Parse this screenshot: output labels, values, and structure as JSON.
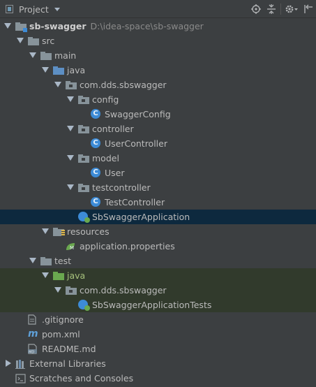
{
  "header": {
    "title": "Project",
    "tools": [
      "target-icon",
      "collapse-icon",
      "gear-icon",
      "hide-icon"
    ]
  },
  "tree": [
    {
      "label": "sb-swagger",
      "hint": "D:\\idea-space\\sb-swagger",
      "icon": "module-folder-icon",
      "indent": 0,
      "toggle": "open",
      "bold": true
    },
    {
      "label": "src",
      "icon": "folder-icon",
      "indent": 1,
      "toggle": "open"
    },
    {
      "label": "main",
      "icon": "folder-icon",
      "indent": 2,
      "toggle": "open"
    },
    {
      "label": "java",
      "icon": "source-folder-icon",
      "indent": 3,
      "toggle": "open"
    },
    {
      "label": "com.dds.sbswagger",
      "icon": "package-icon",
      "indent": 4,
      "toggle": "open"
    },
    {
      "label": "config",
      "icon": "package-icon",
      "indent": 5,
      "toggle": "open"
    },
    {
      "label": "SwaggerConfig",
      "icon": "class-icon",
      "indent": 6,
      "toggle": ""
    },
    {
      "label": "controller",
      "icon": "package-icon",
      "indent": 5,
      "toggle": "open"
    },
    {
      "label": "UserController",
      "icon": "class-icon",
      "indent": 6,
      "toggle": ""
    },
    {
      "label": "model",
      "icon": "package-icon",
      "indent": 5,
      "toggle": "open"
    },
    {
      "label": "User",
      "icon": "class-icon",
      "indent": 6,
      "toggle": ""
    },
    {
      "label": "testcontroller",
      "icon": "package-icon",
      "indent": 5,
      "toggle": "open"
    },
    {
      "label": "TestController",
      "icon": "class-icon",
      "indent": 6,
      "toggle": ""
    },
    {
      "label": "SbSwaggerApplication",
      "icon": "spring-boot-class-icon",
      "indent": 5,
      "toggle": "",
      "selected": true
    },
    {
      "label": "resources",
      "icon": "resources-folder-icon",
      "indent": 3,
      "toggle": "open"
    },
    {
      "label": "application.properties",
      "icon": "spring-properties-icon",
      "indent": 4,
      "toggle": ""
    },
    {
      "label": "test",
      "icon": "folder-icon",
      "indent": 2,
      "toggle": "open"
    },
    {
      "label": "java",
      "icon": "test-source-folder-icon",
      "indent": 3,
      "toggle": "open",
      "test": true,
      "green": true
    },
    {
      "label": "com.dds.sbswagger",
      "icon": "package-icon",
      "indent": 4,
      "toggle": "open",
      "test": true
    },
    {
      "label": "SbSwaggerApplicationTests",
      "icon": "spring-boot-class-icon",
      "indent": 5,
      "toggle": "",
      "test": true
    },
    {
      "label": ".gitignore",
      "icon": "text-file-icon",
      "indent": 1,
      "toggle": ""
    },
    {
      "label": "pom.xml",
      "icon": "maven-icon",
      "indent": 1,
      "toggle": ""
    },
    {
      "label": "README.md",
      "icon": "markdown-file-icon",
      "indent": 1,
      "toggle": ""
    },
    {
      "label": "External Libraries",
      "icon": "external-libraries-icon",
      "indent": 0,
      "toggle": "closed"
    },
    {
      "label": "Scratches and Consoles",
      "icon": "scratches-icon",
      "indent": 0,
      "toggle": ""
    }
  ],
  "colors": {
    "background": "#3c3f41",
    "selection": "#0d293e",
    "test_row": "#313a2c",
    "folder": "#87939a",
    "source_folder": "#5d8fc4",
    "test_folder": "#6aa84f",
    "class": "#3d8bd6"
  }
}
